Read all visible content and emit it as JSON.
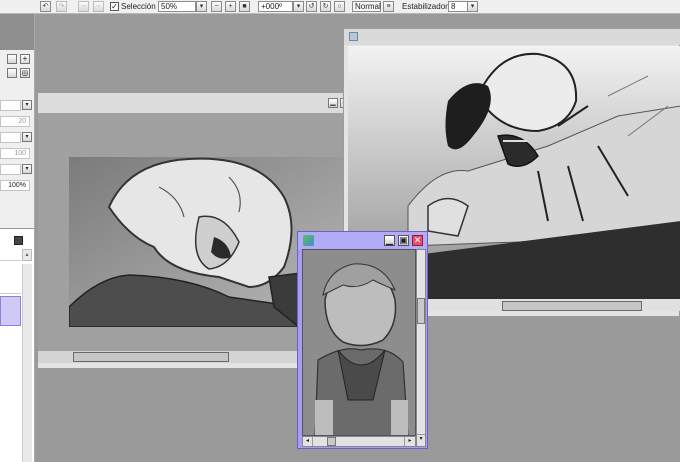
{
  "toolbar": {
    "selection_label": "Selección",
    "selection_checked": "✓",
    "zoom_value": "50%",
    "rotation_value": "+000º",
    "blend_mode_label": "Normal",
    "stabilizer_label": "Estabilizador",
    "stabilizer_value": "8"
  },
  "left_panel": {
    "field_1": "20",
    "field_2": "100",
    "opacity_value": "100%"
  },
  "colors": {
    "navigator_frame": "#a79ef4",
    "close_button": "#e0506a",
    "selected_layer": "#cfc9f5"
  },
  "icons": [
    "undo-icon",
    "redo-icon",
    "select-all-icon",
    "deselect-icon",
    "zoom-out-icon",
    "zoom-in-icon",
    "reset-zoom-icon",
    "rotate-left-icon",
    "rotate-right-icon",
    "reset-rotation-icon",
    "blend-mode-icon",
    "dropdown-arrow-icon",
    "minimize-icon",
    "maximize-icon",
    "close-icon",
    "scroll-arrow-icon"
  ]
}
